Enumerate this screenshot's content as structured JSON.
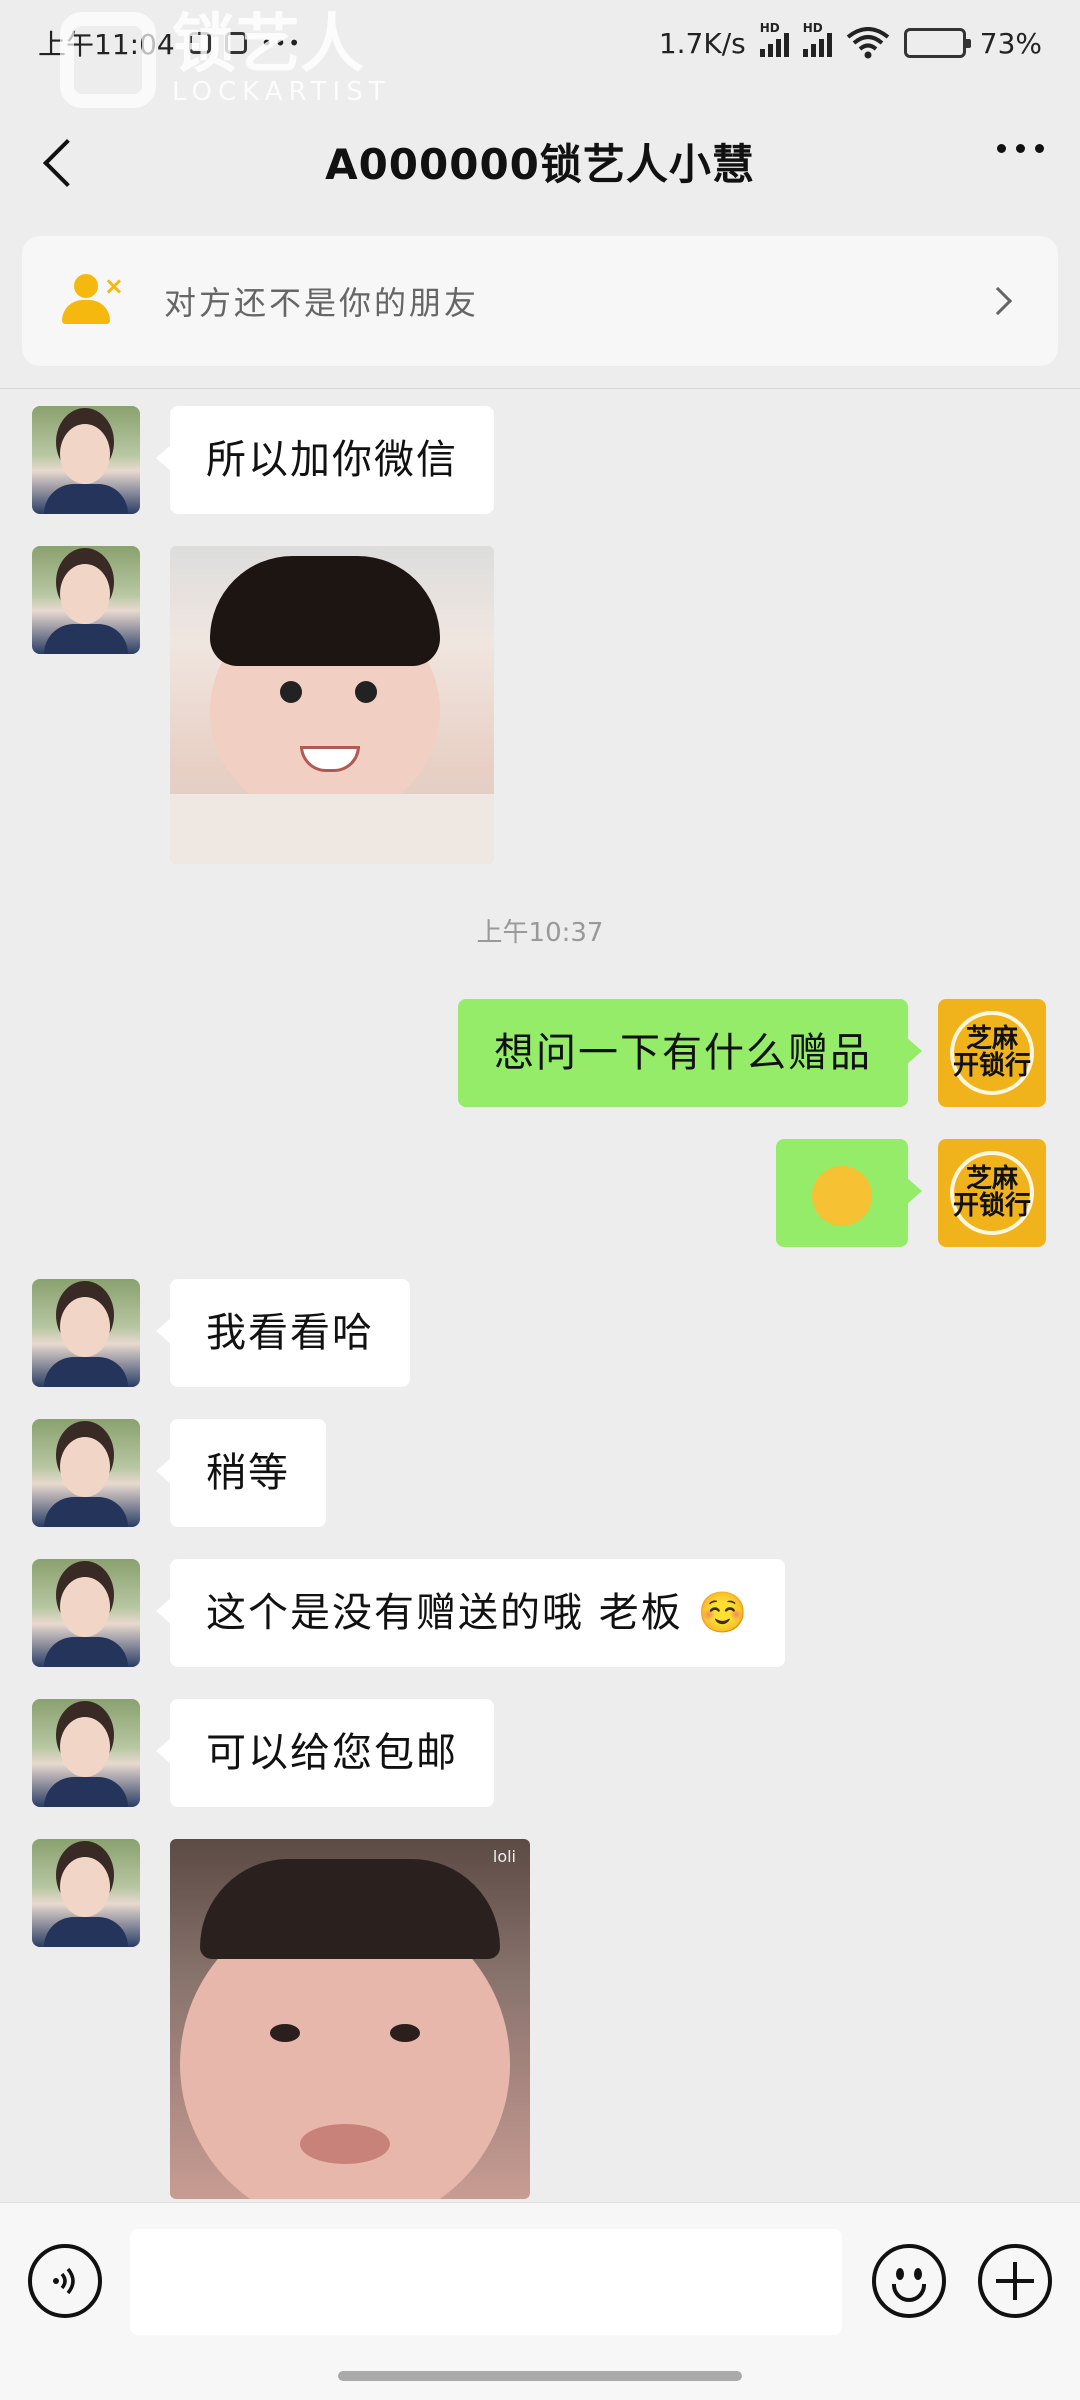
{
  "status_bar": {
    "time": "上午11:04",
    "network_speed": "1.7K/s",
    "hd_label": "HD",
    "battery_percent": "73%",
    "battery_level": 0.73
  },
  "watermark": {
    "cn": "锁艺人",
    "en": "LOCKARTIST"
  },
  "nav": {
    "title": "A000000锁艺人小慧"
  },
  "notice": {
    "text": "对方还不是你的朋友"
  },
  "messages": [
    {
      "side": "in",
      "type": "text",
      "text": "所以加你微信"
    },
    {
      "side": "in",
      "type": "sticker",
      "text": ""
    },
    {
      "type": "time",
      "text": "上午10:37"
    },
    {
      "side": "out",
      "type": "text",
      "text": "想问一下有什么赠品"
    },
    {
      "side": "out",
      "type": "emoji",
      "text": ""
    },
    {
      "side": "in",
      "type": "text",
      "text": "我看看哈"
    },
    {
      "side": "in",
      "type": "text",
      "text": "稍等"
    },
    {
      "side": "in",
      "type": "text",
      "text": "这个是没有赠送的哦  老板"
    },
    {
      "side": "in",
      "type": "text",
      "text": "可以给您包邮"
    },
    {
      "side": "in",
      "type": "sticker",
      "text": ""
    }
  ],
  "shop_avatar": {
    "line1": "芝麻",
    "line2": "开锁行"
  },
  "sticker2_tag": "loli",
  "emoji": {
    "wink": "🫣",
    "blush": "☺️"
  },
  "input": {
    "placeholder": ""
  },
  "colors": {
    "background": "#ededed",
    "outgoing_bubble": "#95ec69",
    "incoming_bubble": "#ffffff",
    "notice_icon": "#f5b80f"
  }
}
